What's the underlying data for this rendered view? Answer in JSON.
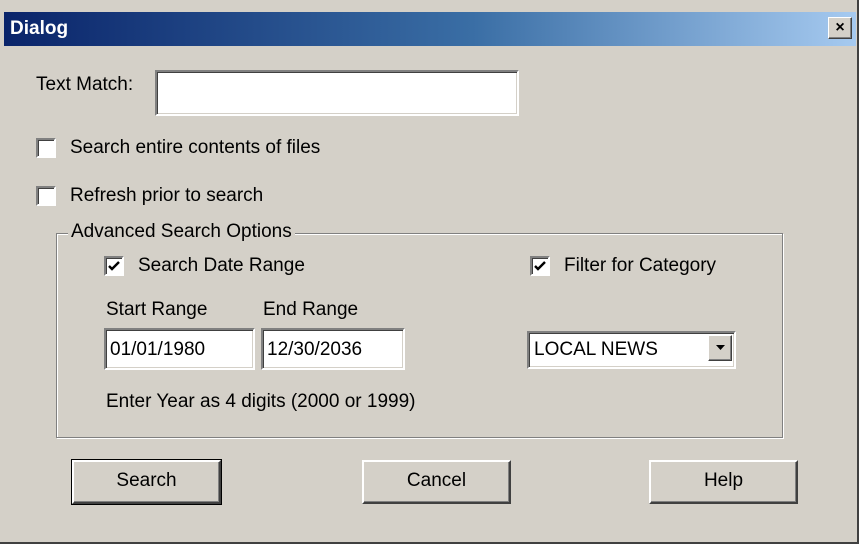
{
  "window": {
    "title": "Dialog",
    "close_glyph": "×"
  },
  "text_match": {
    "label": "Text Match:",
    "value": ""
  },
  "search_contents": {
    "label": "Search entire contents of files",
    "checked": false
  },
  "refresh": {
    "label": "Refresh prior to search",
    "checked": false
  },
  "advanced": {
    "legend": "Advanced Search Options",
    "date_range": {
      "label": "Search Date Range",
      "checked": true
    },
    "category_filter": {
      "label": "Filter for Category",
      "checked": true
    },
    "start_range": {
      "label": "Start Range",
      "value": "01/01/1980"
    },
    "end_range": {
      "label": "End Range",
      "value": "12/30/2036"
    },
    "category": {
      "selected": "LOCAL NEWS"
    },
    "hint": "Enter Year as 4 digits (2000 or 1999)"
  },
  "buttons": {
    "search": "Search",
    "cancel": "Cancel",
    "help": "Help"
  },
  "colors": {
    "face": "#d4d0c8",
    "title_start": "#0a246a",
    "title_end": "#a6caf0"
  },
  "icons": {
    "close": "close-icon",
    "check": "checkmark-icon",
    "dropdown": "chevron-down-icon"
  }
}
